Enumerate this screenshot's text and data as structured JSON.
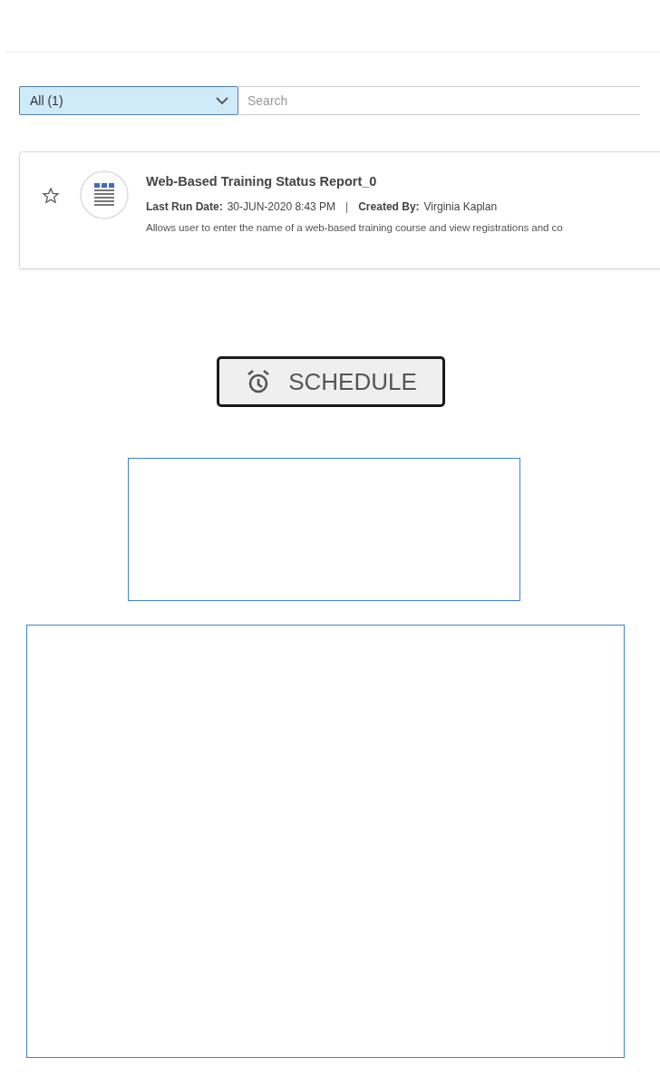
{
  "filter": {
    "value": "All (1)",
    "placeholder": "Search"
  },
  "report": {
    "starred": false,
    "title": "Web-Based Training Status Report_0",
    "last_run_label": "Last Run Date:",
    "last_run_value": "30-JUN-2020  8:43 PM",
    "separator": "|",
    "created_label": "Created By:",
    "created_value": "Virginia Kaplan",
    "description": "Allows user to enter the name of a web-based training course and view registrations and co"
  },
  "schedule_button": {
    "label": "SCHEDULE"
  }
}
